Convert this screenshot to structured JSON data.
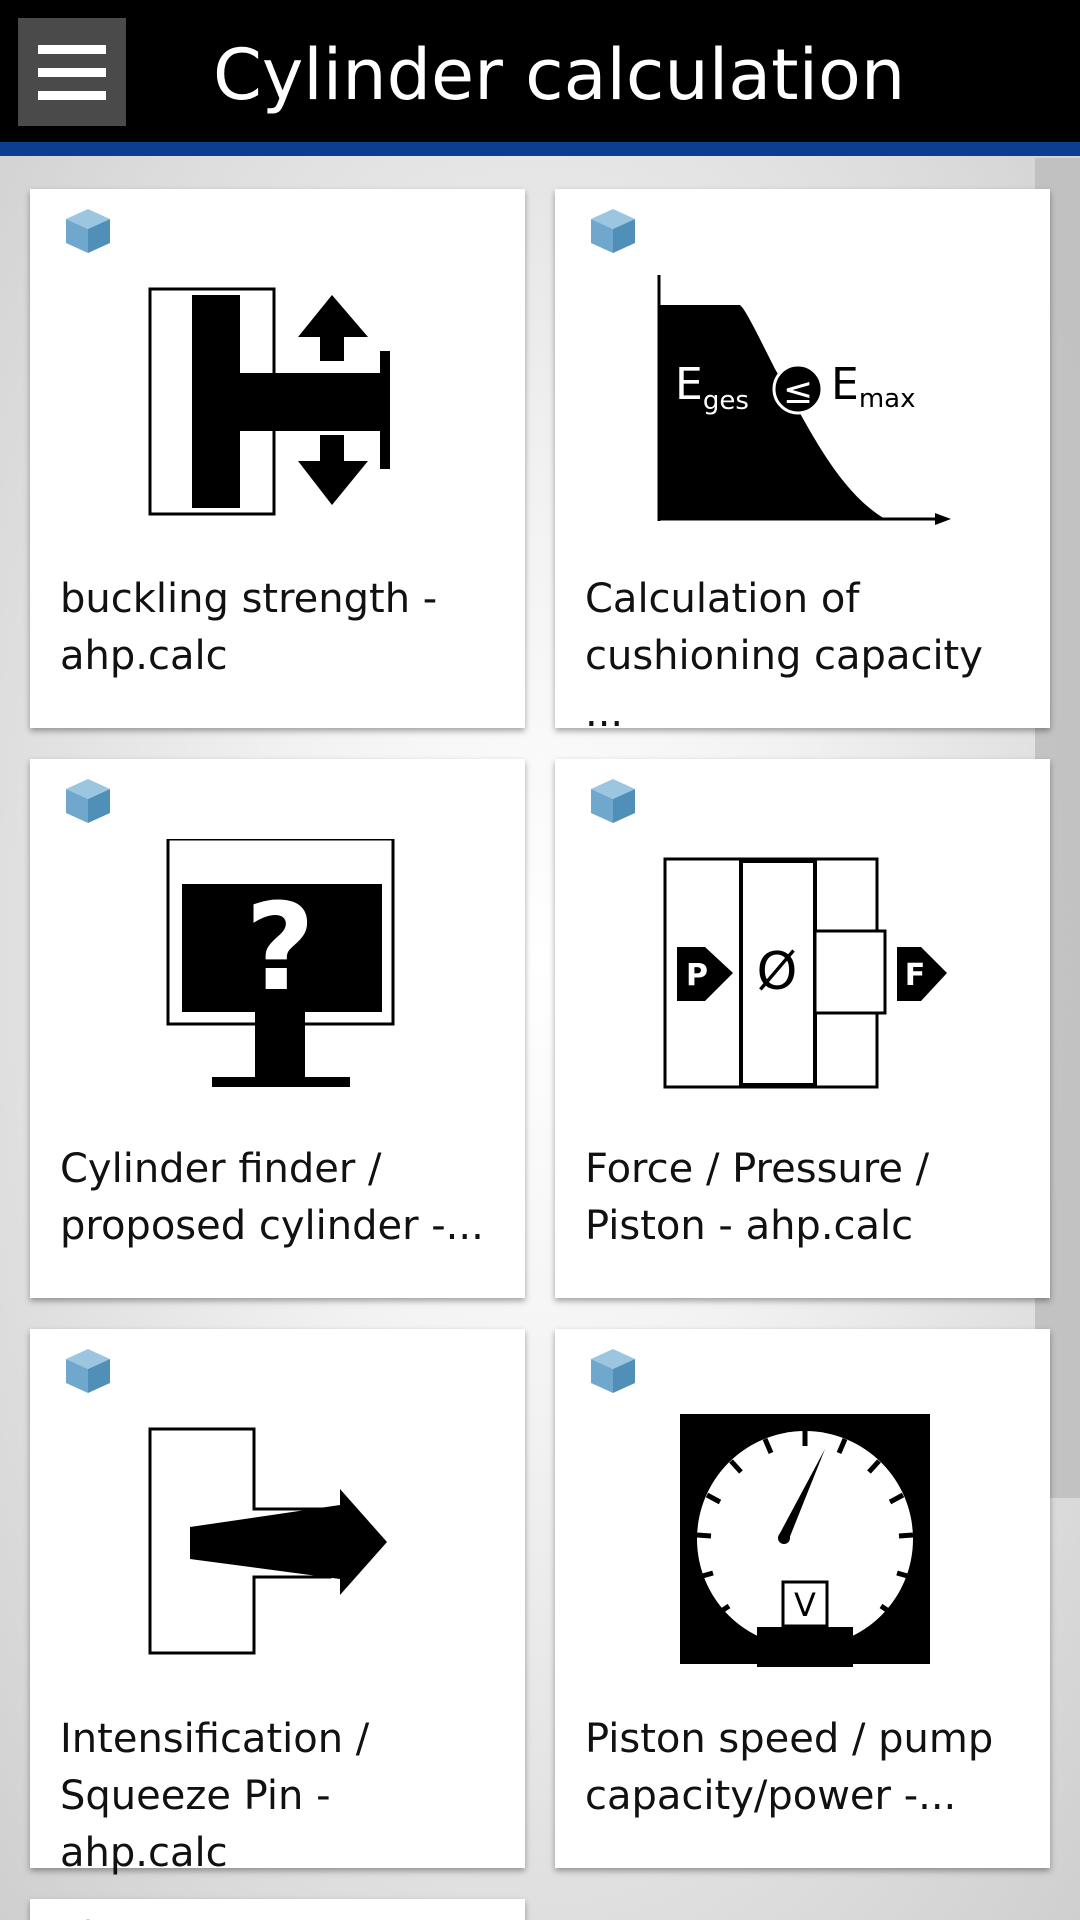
{
  "appbar": {
    "title": "Cylinder calculation",
    "menu_icon": "hamburger-menu-icon"
  },
  "cards": [
    {
      "label_line1": "buckling strength -",
      "label_line2": "ahp.calc",
      "icon": "buckling-cylinder-icon"
    },
    {
      "label_line1": "Calculation of",
      "label_line2": "cushioning capacity ...",
      "icon": "cushioning-energy-chart-icon"
    },
    {
      "label_line1": "Cylinder finder /",
      "label_line2": "proposed cylinder -...",
      "icon": "cylinder-finder-monitor-icon"
    },
    {
      "label_line1": "Force / Pressure /",
      "label_line2": "Piston - ahp.calc",
      "icon": "force-pressure-piston-icon"
    },
    {
      "label_line1": "Intensification /",
      "label_line2": "Squeeze Pin - ahp.calc",
      "icon": "intensification-arrow-icon"
    },
    {
      "label_line1": "Piston speed / pump",
      "label_line2": "capacity/power -...",
      "icon": "gauge-icon"
    }
  ],
  "illustration_text": {
    "eges": "E",
    "eges_sub": "ges",
    "leq": "≤",
    "emax": "E",
    "emax_sub": "max",
    "question": "?",
    "p": "P",
    "diameter": "Ø",
    "f": "F",
    "v": "V"
  },
  "colors": {
    "appbar": "#000000",
    "accent_rule": "#0b3d91",
    "badge": "#6fa8cc"
  }
}
